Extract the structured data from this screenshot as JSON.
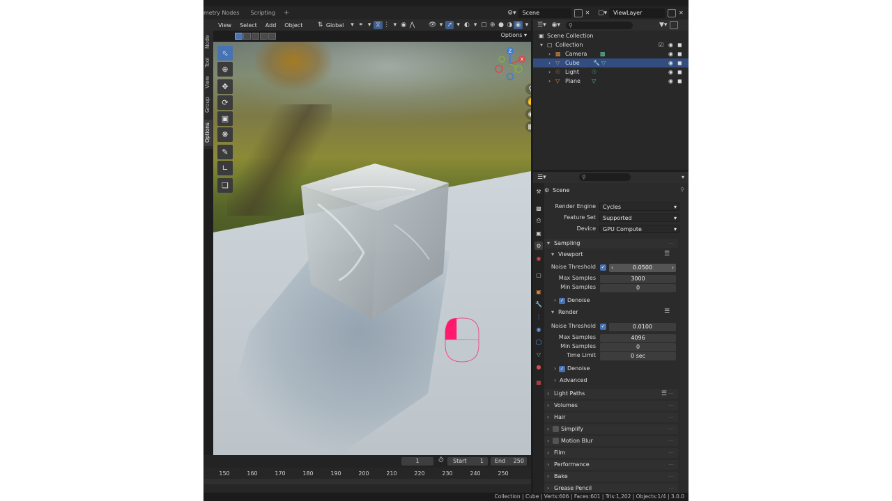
{
  "topbar": {
    "workspace_tabs": [
      "metry Nodes",
      "Scripting"
    ],
    "add_tab": "+",
    "scene": "Scene",
    "view_layer": "ViewLayer"
  },
  "viewport_header": {
    "menus": [
      "View",
      "Select",
      "Add",
      "Object"
    ],
    "orientation": "Global",
    "options": "Options"
  },
  "side_tabs": [
    "Node",
    "Tool",
    "View",
    "Group",
    "Options"
  ],
  "gizmo_axes": {
    "x": "X",
    "y": "Y",
    "z": "Z"
  },
  "timeline": {
    "current_frame": "1",
    "start_label": "Start",
    "start_value": "1",
    "end_label": "End",
    "end_value": "250",
    "ticks": [
      "150",
      "160",
      "170",
      "180",
      "190",
      "200",
      "210",
      "220",
      "230",
      "240",
      "250"
    ]
  },
  "status_bar": {
    "text": "Collection | Cube | Verts:606 | Faces:601 | Tris:1,202 | Objects:1/4 | 3.0.0"
  },
  "outliner": {
    "root": "Scene Collection",
    "collection": "Collection",
    "items": [
      {
        "name": "Camera",
        "selected": false
      },
      {
        "name": "Cube",
        "selected": true
      },
      {
        "name": "Light",
        "selected": false
      },
      {
        "name": "Plane",
        "selected": false
      }
    ]
  },
  "properties": {
    "context": "Scene",
    "render_engine_label": "Render Engine",
    "render_engine": "Cycles",
    "feature_set_label": "Feature Set",
    "feature_set": "Supported",
    "device_label": "Device",
    "device": "GPU Compute",
    "sampling": "Sampling",
    "viewport": {
      "title": "Viewport",
      "noise_threshold_label": "Noise Threshold",
      "noise_threshold": "0.0500",
      "max_samples_label": "Max Samples",
      "max_samples": "3000",
      "min_samples_label": "Min Samples",
      "min_samples": "0",
      "denoise": "Denoise"
    },
    "render": {
      "title": "Render",
      "noise_threshold_label": "Noise Threshold",
      "noise_threshold": "0.0100",
      "max_samples_label": "Max Samples",
      "max_samples": "4096",
      "min_samples_label": "Min Samples",
      "min_samples": "0",
      "time_limit_label": "Time Limit",
      "time_limit": "0 sec",
      "denoise": "Denoise"
    },
    "advanced": "Advanced",
    "panels": [
      "Light Paths",
      "Volumes",
      "Hair",
      "Simplify",
      "Motion Blur",
      "Film",
      "Performance",
      "Bake",
      "Grease Pencil"
    ]
  },
  "colors": {
    "selection": "#334d80",
    "accent": "#4772b3",
    "mouse_highlight": "#ff1a6e"
  }
}
